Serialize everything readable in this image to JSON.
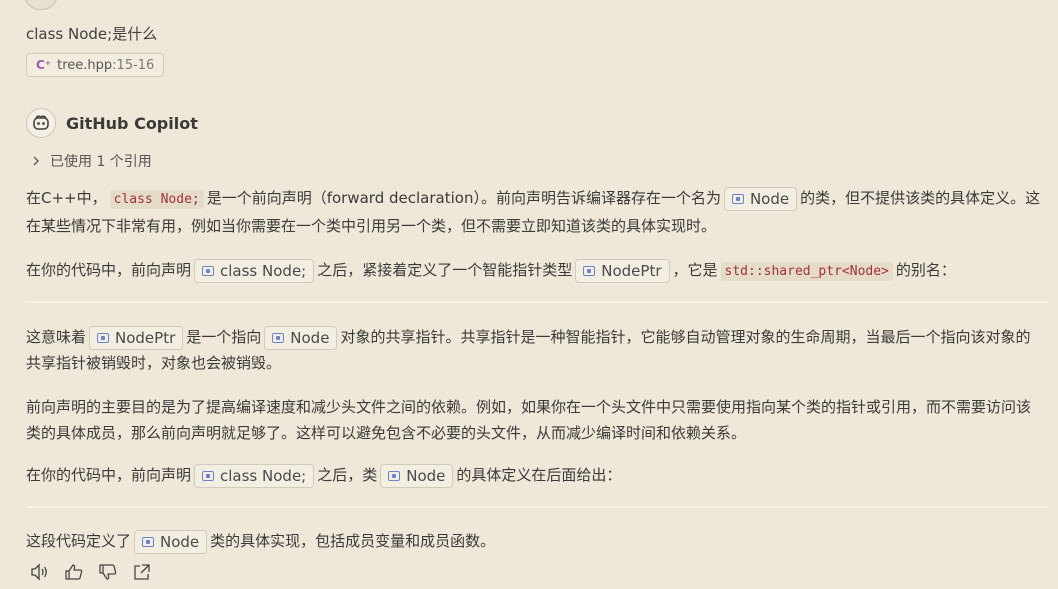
{
  "question": {
    "text": "class Node;是什么",
    "ref_file": "tree.hpp",
    "ref_lines": ":15-16"
  },
  "response": {
    "author": "GitHub Copilot",
    "refs_label": "已使用 1 个引用",
    "p1": {
      "a": "在C++中，",
      "code": "class Node;",
      "b": "是一个前向声明（forward declaration）。前向声明告诉编译器存在一个名为",
      "chip": "Node",
      "c": "的类，但不提供该类的具体定义。这在某些情况下非常有用，例如当你需要在一个类中引用另一个类，但不需要立即知道该类的具体实现时。"
    },
    "p2": {
      "a": "在你的代码中，前向声明",
      "chip1": "class Node;",
      "b": "之后，紧接着定义了一个智能指针类型",
      "chip2": "NodePtr",
      "c": "，它是",
      "code": "std::shared_ptr<Node>",
      "d": "的别名："
    },
    "p3": {
      "a": "这意味着",
      "chip1": "NodePtr",
      "b": "是一个指向",
      "chip2": "Node",
      "c": "对象的共享指针。共享指针是一种智能指针，它能够自动管理对象的生命周期，当最后一个指向该对象的共享指针被销毁时，对象也会被销毁。"
    },
    "p4": "前向声明的主要目的是为了提高编译速度和减少头文件之间的依赖。例如，如果你在一个头文件中只需要使用指向某个类的指针或引用，而不需要访问该类的具体成员，那么前向声明就足够了。这样可以避免包含不必要的头文件，从而减少编译时间和依赖关系。",
    "p5": {
      "a": "在你的代码中，前向声明",
      "chip1": "class Node;",
      "b": "之后，类",
      "chip2": "Node",
      "c": "的具体定义在后面给出："
    },
    "p6": {
      "a": "这段代码定义了",
      "chip": "Node",
      "b": "类的具体实现，包括成员变量和成员函数。"
    }
  },
  "icons": {
    "read_aloud": "speaker-icon",
    "helpful": "thumbs-up-icon",
    "unhelpful": "thumbs-down-icon",
    "insert": "insert-icon"
  }
}
